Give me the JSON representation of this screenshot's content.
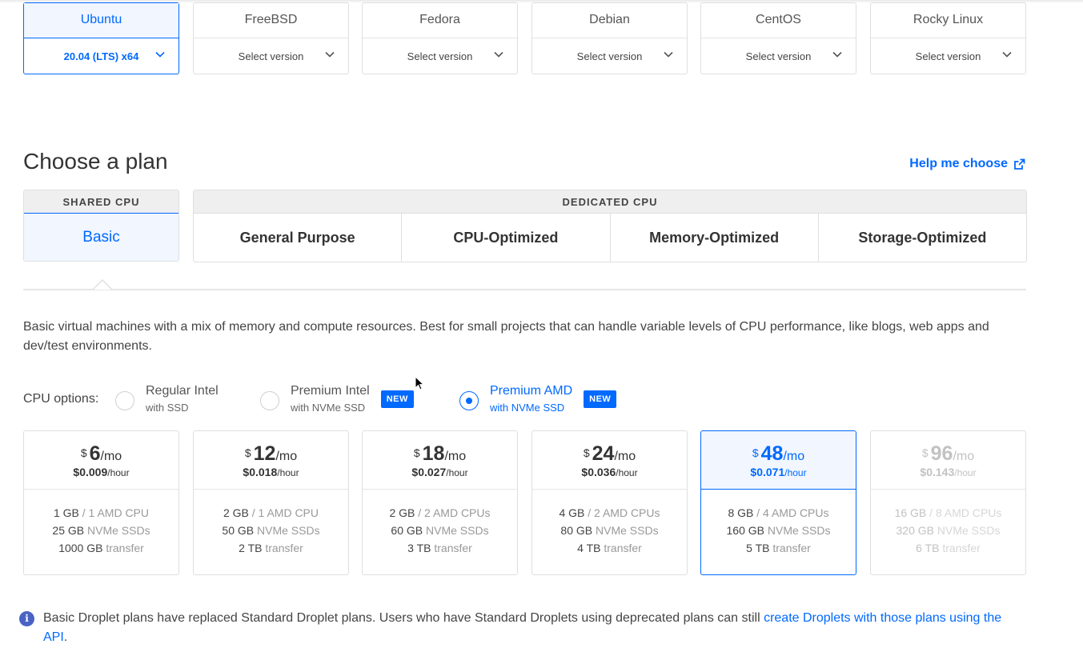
{
  "os": [
    {
      "name": "Ubuntu",
      "version": "20.04 (LTS) x64",
      "selected": true
    },
    {
      "name": "FreeBSD",
      "version": "Select version"
    },
    {
      "name": "Fedora",
      "version": "Select version"
    },
    {
      "name": "Debian",
      "version": "Select version"
    },
    {
      "name": "CentOS",
      "version": "Select version"
    },
    {
      "name": "Rocky Linux",
      "version": "Select version"
    }
  ],
  "plan_section": {
    "title": "Choose a plan",
    "help_link": "Help me choose",
    "shared_label": "SHARED CPU",
    "dedicated_label": "DEDICATED CPU",
    "shared_tabs": [
      "Basic"
    ],
    "dedicated_tabs": [
      "General Purpose",
      "CPU-Optimized",
      "Memory-Optimized",
      "Storage-Optimized"
    ],
    "description": "Basic virtual machines with a mix of memory and compute resources. Best for small projects that can handle variable levels of CPU performance, like blogs, web apps and dev/test environments."
  },
  "cpu_options": {
    "label": "CPU options:",
    "options": [
      {
        "title": "Regular Intel",
        "subtitle": "with SSD",
        "badge": "",
        "selected": false
      },
      {
        "title": "Premium Intel",
        "subtitle": "with NVMe SSD",
        "badge": "NEW",
        "selected": false
      },
      {
        "title": "Premium AMD",
        "subtitle": "with NVMe SSD",
        "badge": "NEW",
        "selected": true
      }
    ]
  },
  "price_cards": [
    {
      "currency": "$",
      "amount": "6",
      "per": "/mo",
      "hourly": "$0.009",
      "hourly_unit": "/hour",
      "mem": "1 GB",
      "cpu": "/ 1 AMD CPU",
      "disk": "25 GB",
      "disk_unit": "NVMe SSDs",
      "transfer": "1000 GB",
      "transfer_unit": "transfer"
    },
    {
      "currency": "$",
      "amount": "12",
      "per": "/mo",
      "hourly": "$0.018",
      "hourly_unit": "/hour",
      "mem": "2 GB",
      "cpu": "/ 1 AMD CPU",
      "disk": "50 GB",
      "disk_unit": "NVMe SSDs",
      "transfer": "2 TB",
      "transfer_unit": "transfer"
    },
    {
      "currency": "$",
      "amount": "18",
      "per": "/mo",
      "hourly": "$0.027",
      "hourly_unit": "/hour",
      "mem": "2 GB",
      "cpu": "/ 2 AMD CPUs",
      "disk": "60 GB",
      "disk_unit": "NVMe SSDs",
      "transfer": "3 TB",
      "transfer_unit": "transfer"
    },
    {
      "currency": "$",
      "amount": "24",
      "per": "/mo",
      "hourly": "$0.036",
      "hourly_unit": "/hour",
      "mem": "4 GB",
      "cpu": "/ 2 AMD CPUs",
      "disk": "80 GB",
      "disk_unit": "NVMe SSDs",
      "transfer": "4 TB",
      "transfer_unit": "transfer"
    },
    {
      "currency": "$",
      "amount": "48",
      "per": "/mo",
      "hourly": "$0.071",
      "hourly_unit": "/hour",
      "mem": "8 GB",
      "cpu": "/ 4 AMD CPUs",
      "disk": "160 GB",
      "disk_unit": "NVMe SSDs",
      "transfer": "5 TB",
      "transfer_unit": "transfer",
      "selected": true
    },
    {
      "currency": "$",
      "amount": "96",
      "per": "/mo",
      "hourly": "$0.143",
      "hourly_unit": "/hour",
      "mem": "16 GB",
      "cpu": "/ 8 AMD CPUs",
      "disk": "320 GB",
      "disk_unit": "NVMe SSDs",
      "transfer": "6 TB",
      "transfer_unit": "transfer",
      "disabled": true
    }
  ],
  "notice": {
    "text": "Basic Droplet plans have replaced Standard Droplet plans. Users who have Standard Droplets using deprecated plans can still ",
    "link": "create Droplets with those plans using the API",
    "suffix": "."
  },
  "colors": {
    "accent": "#0069ff",
    "selected_bg": "#f1f6ff",
    "border": "#dfdfdf"
  }
}
